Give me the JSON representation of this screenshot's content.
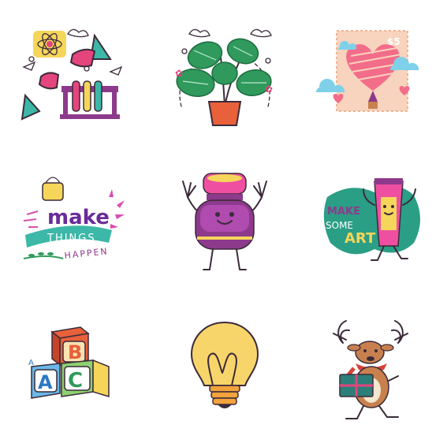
{
  "stickers": [
    {
      "id": "science-lab",
      "icon": "science-lab-icon"
    },
    {
      "id": "plant",
      "icon": "potted-plant-icon"
    },
    {
      "id": "heart-stamp",
      "icon": "heart-balloon-stamp-icon",
      "price": "$5"
    },
    {
      "id": "make-things-happen",
      "icon": "lightbulb-lettering-icon",
      "line1": "make",
      "line2": "THINGS",
      "line3": "HAPPEN"
    },
    {
      "id": "paint-jar",
      "icon": "paint-jar-character-icon"
    },
    {
      "id": "make-some-art",
      "icon": "paint-tube-character-icon",
      "line1": "MAKE",
      "line2": "SOME",
      "line3": "ART"
    },
    {
      "id": "abc-blocks",
      "icon": "abc-blocks-icon",
      "letters": [
        "B",
        "A",
        "A",
        "C"
      ]
    },
    {
      "id": "light-bulb",
      "icon": "light-bulb-icon"
    },
    {
      "id": "reindeer",
      "icon": "reindeer-gift-icon"
    }
  ],
  "colors": {
    "pink": "#e3457c",
    "purple": "#8d3a8c",
    "teal": "#3cb7a8",
    "yellow": "#f6d65a",
    "green": "#2f9a5c",
    "orange": "#e8613a"
  }
}
